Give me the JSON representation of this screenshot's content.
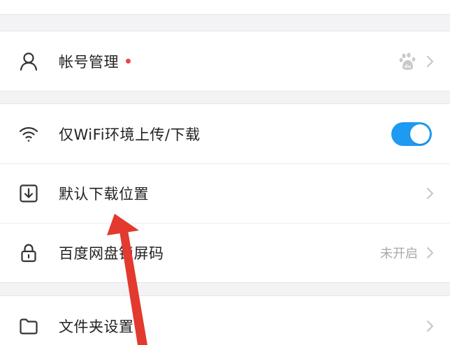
{
  "settings": {
    "groups": [
      {
        "rows": [
          {
            "label": "帐号管理",
            "icon": "user-icon",
            "has_red_dot": true,
            "right": "baidu-logo"
          }
        ]
      },
      {
        "rows": [
          {
            "label": "仅WiFi环境上传/下载",
            "icon": "wifi-icon",
            "right": "toggle",
            "toggle_on": true
          },
          {
            "label": "默认下载位置",
            "icon": "download-icon",
            "right": "chevron"
          },
          {
            "label": "百度网盘锁屏码",
            "icon": "lock-icon",
            "value": "未开启",
            "right": "chevron"
          }
        ]
      },
      {
        "rows": [
          {
            "label": "文件夹设置",
            "icon": "folder-icon",
            "right": "chevron"
          }
        ]
      }
    ]
  },
  "annotation": {
    "type": "red-arrow",
    "color": "#e23a2e",
    "points_to": "默认下载位置"
  },
  "colors": {
    "accent": "#1e9af2",
    "red_dot": "#f04444",
    "background": "#f3f3f5",
    "label_text": "#222222",
    "secondary_text": "#a9a9ad"
  }
}
